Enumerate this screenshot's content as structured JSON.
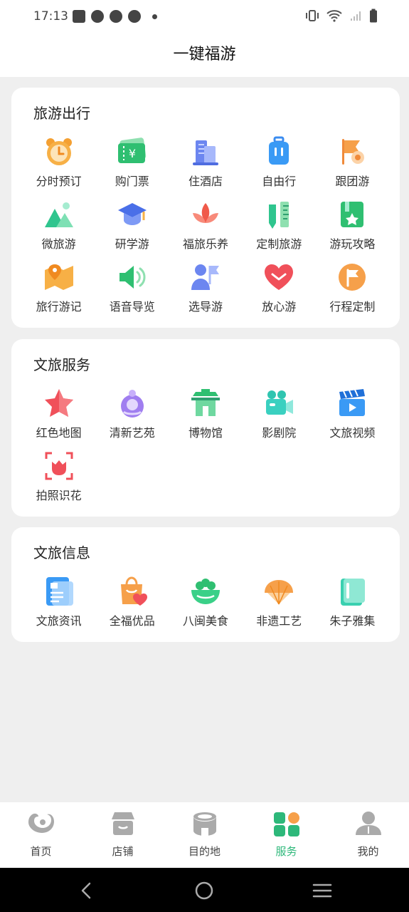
{
  "status": {
    "time": "17:13"
  },
  "header": {
    "title": "一键福游"
  },
  "sections": [
    {
      "title": "旅游出行",
      "items": [
        {
          "label": "分时预订",
          "icon": "alarm-clock-icon"
        },
        {
          "label": "购门票",
          "icon": "ticket-icon"
        },
        {
          "label": "住酒店",
          "icon": "hotel-building-icon"
        },
        {
          "label": "自由行",
          "icon": "suitcase-icon"
        },
        {
          "label": "跟团游",
          "icon": "flag-location-icon"
        },
        {
          "label": "微旅游",
          "icon": "mountain-icon"
        },
        {
          "label": "研学游",
          "icon": "graduation-cap-icon"
        },
        {
          "label": "福旅乐养",
          "icon": "lotus-icon"
        },
        {
          "label": "定制旅游",
          "icon": "pencil-ruler-icon"
        },
        {
          "label": "游玩攻略",
          "icon": "guide-book-icon"
        },
        {
          "label": "旅行游记",
          "icon": "map-pin-icon"
        },
        {
          "label": "语音导览",
          "icon": "speaker-icon"
        },
        {
          "label": "选导游",
          "icon": "guide-person-icon"
        },
        {
          "label": "放心游",
          "icon": "heart-icon"
        },
        {
          "label": "行程定制",
          "icon": "itinerary-flag-icon"
        }
      ]
    },
    {
      "title": "文旅服务",
      "items": [
        {
          "label": "红色地图",
          "icon": "red-star-icon"
        },
        {
          "label": "清新艺苑",
          "icon": "art-figure-icon"
        },
        {
          "label": "博物馆",
          "icon": "museum-icon"
        },
        {
          "label": "影剧院",
          "icon": "video-camera-icon"
        },
        {
          "label": "文旅视频",
          "icon": "clapperboard-icon"
        },
        {
          "label": "拍照识花",
          "icon": "flower-scan-icon"
        }
      ]
    },
    {
      "title": "文旅信息",
      "items": [
        {
          "label": "文旅资讯",
          "icon": "news-icon"
        },
        {
          "label": "全福优品",
          "icon": "shopping-bag-icon"
        },
        {
          "label": "八闽美食",
          "icon": "food-bowl-icon"
        },
        {
          "label": "非遗工艺",
          "icon": "folding-fan-icon"
        },
        {
          "label": "朱子雅集",
          "icon": "book-icon"
        }
      ]
    }
  ],
  "bottom_nav": [
    {
      "label": "首页",
      "icon": "home-logo-icon",
      "active": false
    },
    {
      "label": "店铺",
      "icon": "store-icon",
      "active": false
    },
    {
      "label": "目的地",
      "icon": "destination-icon",
      "active": false
    },
    {
      "label": "服务",
      "icon": "services-grid-icon",
      "active": true
    },
    {
      "label": "我的",
      "icon": "profile-icon",
      "active": false
    }
  ],
  "colors": {
    "accent": "#2db87a",
    "background": "#efefef"
  }
}
